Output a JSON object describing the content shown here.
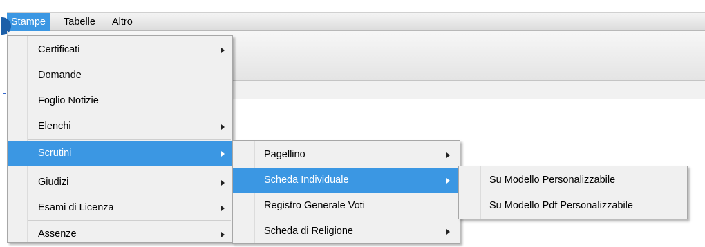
{
  "menubar": {
    "items": [
      {
        "label": "Stampe",
        "active": true
      },
      {
        "label": "Tabelle",
        "active": false
      },
      {
        "label": "Altro",
        "active": false
      }
    ]
  },
  "menu_stampe": {
    "items": [
      {
        "label": "Certificati",
        "submenu": true
      },
      {
        "label": "Domande",
        "submenu": false
      },
      {
        "label": "Foglio Notizie",
        "submenu": false
      },
      {
        "label": "Elenchi",
        "submenu": true
      },
      {
        "label": "Scrutini",
        "submenu": true,
        "highlighted": true
      },
      {
        "label": "Giudizi",
        "submenu": true
      },
      {
        "label": "Esami di Licenza",
        "submenu": true
      },
      {
        "label": "Assenze",
        "submenu": true
      }
    ]
  },
  "menu_scrutini": {
    "items": [
      {
        "label": "Pagellino",
        "submenu": true
      },
      {
        "label": "Scheda Individuale",
        "submenu": true,
        "highlighted": true
      },
      {
        "label": "Registro Generale Voti",
        "submenu": false
      },
      {
        "label": "Scheda di Religione",
        "submenu": true
      }
    ]
  },
  "menu_scheda_individuale": {
    "items": [
      {
        "label": "Su Modello Personalizzabile"
      },
      {
        "label": "Su Modello Pdf Personalizzabile"
      }
    ]
  },
  "colors": {
    "highlight": "#3b97e3",
    "menu_background": "#f0f0f0",
    "menu_border": "#a7a7a7"
  }
}
